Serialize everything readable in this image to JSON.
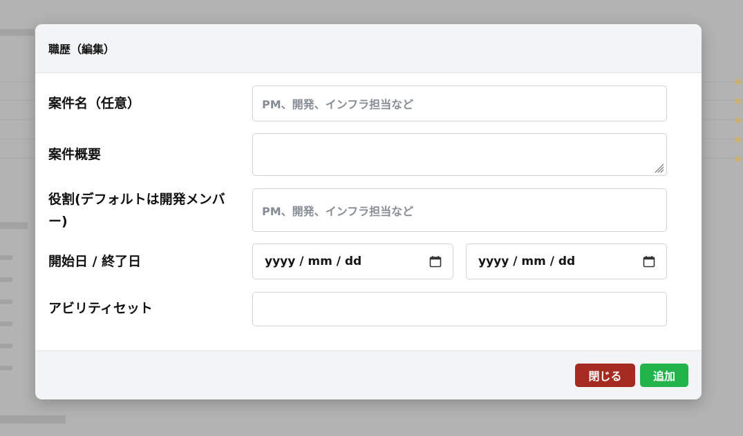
{
  "modal": {
    "title": "職歴（編集）"
  },
  "form": {
    "project_name": {
      "label": "案件名（任意）",
      "placeholder": "PM、開発、インフラ担当など",
      "value": ""
    },
    "project_summary": {
      "label": "案件概要",
      "value": ""
    },
    "role": {
      "label": "役割(デフォルトは開発メンバー)",
      "placeholder": "PM、開発、インフラ担当など",
      "value": ""
    },
    "dates": {
      "label": "開始日 / 終了日",
      "start_placeholder": "yyyy / mm / dd",
      "end_placeholder": "yyyy / mm / dd",
      "icon": "calendar-icon"
    },
    "ability_set": {
      "label": "アビリティセット",
      "value": ""
    }
  },
  "footer": {
    "close_label": "閉じる",
    "add_label": "追加"
  },
  "colors": {
    "close_button": "#a52a1f",
    "add_button": "#22b34a",
    "header_bg": "#f3f4f6",
    "overlay": "#b3b3b3"
  }
}
